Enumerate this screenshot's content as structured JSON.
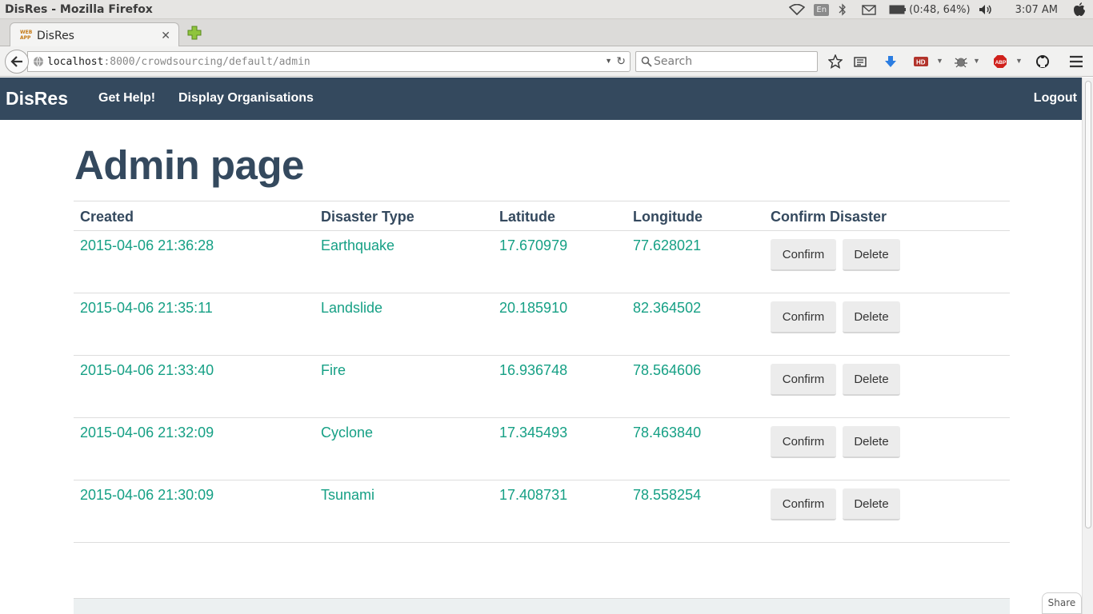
{
  "os": {
    "window_title": "DisRes - Mozilla Firefox",
    "lang": "En",
    "battery": "(0:48, 64%)",
    "clock": "3:07 AM"
  },
  "browser": {
    "tab_title": "DisRes",
    "url_host": "localhost",
    "url_rest": ":8000/crowdsourcing/default/admin",
    "search_placeholder": "Search",
    "share_label": "Share"
  },
  "app": {
    "brand": "DisRes",
    "nav": {
      "get_help": "Get Help!",
      "display_orgs": "Display Organisations",
      "logout": "Logout"
    },
    "page_title": "Admin page",
    "table": {
      "headers": {
        "created": "Created",
        "disaster_type": "Disaster Type",
        "latitude": "Latitude",
        "longitude": "Longitude",
        "confirm_disaster": "Confirm Disaster"
      },
      "confirm_label": "Confirm",
      "delete_label": "Delete",
      "rows": [
        {
          "created": "2015-04-06 21:36:28",
          "type": "Earthquake",
          "lat": "17.670979",
          "lng": "77.628021"
        },
        {
          "created": "2015-04-06 21:35:11",
          "type": "Landslide",
          "lat": "20.185910",
          "lng": "82.364502"
        },
        {
          "created": "2015-04-06 21:33:40",
          "type": "Fire",
          "lat": "16.936748",
          "lng": "78.564606"
        },
        {
          "created": "2015-04-06 21:32:09",
          "type": "Cyclone",
          "lat": "17.345493",
          "lng": "78.463840"
        },
        {
          "created": "2015-04-06 21:30:09",
          "type": "Tsunami",
          "lat": "17.408731",
          "lng": "78.558254"
        }
      ]
    }
  },
  "colors": {
    "navbar": "#34495e",
    "accent_text": "#16a085",
    "title": "#34495e"
  }
}
